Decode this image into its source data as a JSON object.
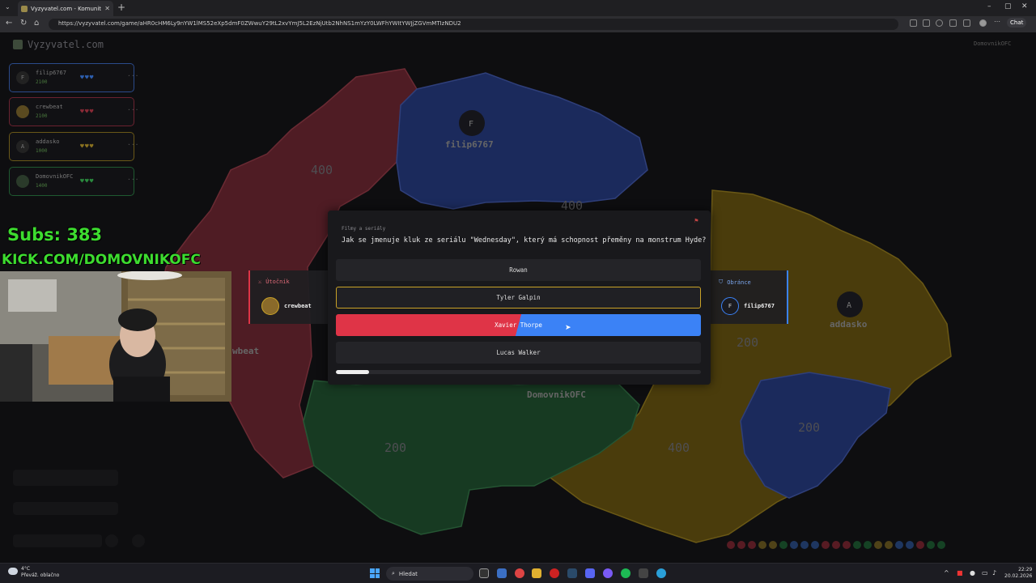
{
  "browser": {
    "tab_title": "Vyzyvatel.com - Komunitní vědom",
    "url": "https://vyzyvatel.com/game/aHR0cHM6Ly9nYW1lMS52eXp5dmF0ZWwuY29tL2xvYmJ5L2EzNjUtb2NhNS1mYzY0LWFhYWItYWJjZGVmMTIzNDU2",
    "chat_label": "Chat"
  },
  "game": {
    "logo": "Vyzyvatel.com",
    "top_right_player": "DomovnikOFC",
    "players": [
      {
        "initial": "F",
        "name": "filip6767",
        "score": "2100",
        "hearts": "♥♥♥",
        "color": "#3b82f6"
      },
      {
        "initial": "",
        "name": "crewbeat",
        "score": "2100",
        "hearts": "♥♥♥",
        "color": "#df3447"
      },
      {
        "initial": "A",
        "name": "addasko",
        "score": "1000",
        "hearts": "♥♥♥",
        "color": "#c9a227"
      },
      {
        "initial": "",
        "name": "DomovnikOFC",
        "score": "1400",
        "hearts": "♥♥♥",
        "color": "#22a34a"
      }
    ],
    "more_label": "···",
    "map": {
      "regions": [
        {
          "value": "400",
          "owner": "crewbeat"
        },
        {
          "value": "400",
          "owner": "filip6767"
        },
        {
          "value": "200",
          "owner": "DomovnikOFC"
        },
        {
          "value": "200",
          "owner": "addasko"
        },
        {
          "value": "200",
          "owner": "filip6767"
        },
        {
          "value": "400",
          "owner": "addasko"
        },
        {
          "value": "200",
          "owner": "crewbeat"
        }
      ],
      "labels": {
        "filip": "filip6767",
        "filip_initial": "F",
        "addasko": "addasko",
        "addasko_initial": "A",
        "crewbeat": "wbeat",
        "domovnik": "DomovnikOFC"
      }
    },
    "attacker": {
      "title": "Útočník",
      "name": "crewbeat",
      "color": "#df3447"
    },
    "defender": {
      "title": "Obránce",
      "name": "filip6767",
      "initial": "F",
      "color": "#3b82f6"
    },
    "question": {
      "category": "Filmy a seriály",
      "text": "Jak se jmenuje kluk ze seriálu \"Wednesday\", který má schopnost přeměny na monstrum Hyde?",
      "answers": [
        "Rowan",
        "Tyler Galpin",
        "Xavier Thorpe",
        "Lucas Walker"
      ],
      "selected_answer": "Tyler Galpin",
      "contested_answer": "Xavier Thorpe",
      "timer_progress": 0.09
    }
  },
  "overlay": {
    "subs": "Subs: 383",
    "kick": "KICK.COM/DOMOVNIKOFC"
  },
  "taskbar": {
    "weather_temp": "4°C",
    "weather_desc": "Převáž. oblačno",
    "search_placeholder": "Hledat",
    "time": "22:29",
    "date": "20.02.2026"
  }
}
